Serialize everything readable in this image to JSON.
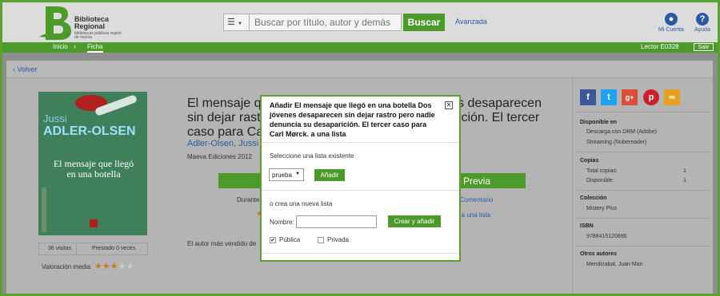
{
  "header": {
    "logo_name": "Biblioteca Regional",
    "logo_sub": "bibliotecas públicas región de murcia",
    "search_placeholder": "Buscar por título, autor y demás",
    "search_button": "Buscar",
    "advanced": "Avanzada",
    "account": "Mi Cuenta",
    "help": "Ayuda"
  },
  "nav": {
    "crumbs": [
      "Inicio",
      "Ficha"
    ],
    "reader": "Lector E0328",
    "logout": "Salir"
  },
  "back": "Volver",
  "book": {
    "title": "El mensaje que llegó en una botella Dos jóvenes desaparecen sin dejar rastro pero nadie denuncia su desaparición. El tercer caso para Carl Mørck",
    "author": "Adler-Olsen, Jussi",
    "publisher": "Maeva Ediciones 2012",
    "preview": "Previa",
    "durante": "Durante",
    "comment": "r Comentario",
    "add_list": "ir a una lista",
    "most_read": "El autor más vendido de",
    "cover": {
      "author_first": "Jussi",
      "author_last": "ADLER-OLSEN",
      "title": "El mensaje que llegó en una botella"
    },
    "stats": {
      "visits": "36 visitas",
      "loaned": "Prestado 0 veces"
    },
    "rating_label": "Valoración media",
    "rating": 3,
    "rating_max": 5
  },
  "sidebar": {
    "share_icons": [
      "facebook-icon",
      "twitter-icon",
      "googleplus-icon",
      "pinterest-icon",
      "link-icon"
    ],
    "available_title": "Disponible en",
    "available": [
      "Descarga con DRM (Adobe)",
      "Streaming (Nubereader)"
    ],
    "copies_title": "Copias",
    "total_label": "Total copias:",
    "total_value": "1",
    "avail_label": "Disponible:",
    "avail_value": "1",
    "collection_title": "Colección",
    "collection": "Mistery Plus",
    "isbn_title": "ISBN",
    "isbn": "9788415120896",
    "others_title": "Otros autores",
    "others": "Mendizabal, Juan Mari"
  },
  "modal": {
    "title": "Añadir El mensaje que llegó en una botella Dos jóvenes desaparecen sin dejar rastro pero nadie denuncia su desaparición. El tercer caso para Carl Mørck. a una lista",
    "select_existing": "Seleccione una lista existente",
    "selected_list": "prueba",
    "add_button": "Añadir",
    "or_create": "o crea una nueva lista",
    "name_label": "Nombre:",
    "create_button": "Crear y añadir",
    "public_label": "Pública",
    "private_label": "Privada",
    "public_checked": true
  },
  "colors": {
    "accent": "#4c9a2a",
    "link": "#2a5aa0",
    "star": "#c47a16"
  }
}
